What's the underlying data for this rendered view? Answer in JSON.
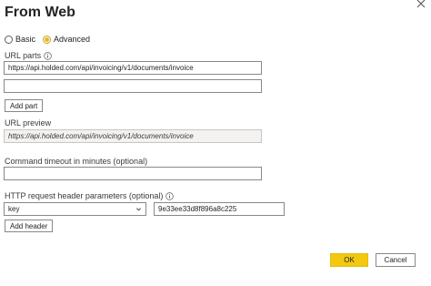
{
  "dialog": {
    "title": "From Web"
  },
  "mode": {
    "basic_label": "Basic",
    "advanced_label": "Advanced",
    "selected": "Advanced"
  },
  "url_parts": {
    "label": "URL parts",
    "part1_value": "https://api.holded.com/api/invoicing/v1/documents/invoice",
    "part2_value": "",
    "add_part_label": "Add part"
  },
  "url_preview": {
    "label": "URL preview",
    "value": "https://api.holded.com/api/invoicing/v1/documents/invoice"
  },
  "timeout": {
    "label": "Command timeout in minutes (optional)",
    "value": ""
  },
  "headers": {
    "label": "HTTP request header parameters (optional)",
    "key_value": "key",
    "value_value": "9e33ee33d8f896a8c225",
    "add_header_label": "Add header"
  },
  "footer": {
    "ok_label": "OK",
    "cancel_label": "Cancel"
  },
  "colors": {
    "accent": "#f2c811",
    "radio_selected": "#e5b81e",
    "text": "#252423"
  },
  "icons": {
    "close": "close-icon",
    "info": "info-icon",
    "dropdown": "chevron-down-icon"
  }
}
